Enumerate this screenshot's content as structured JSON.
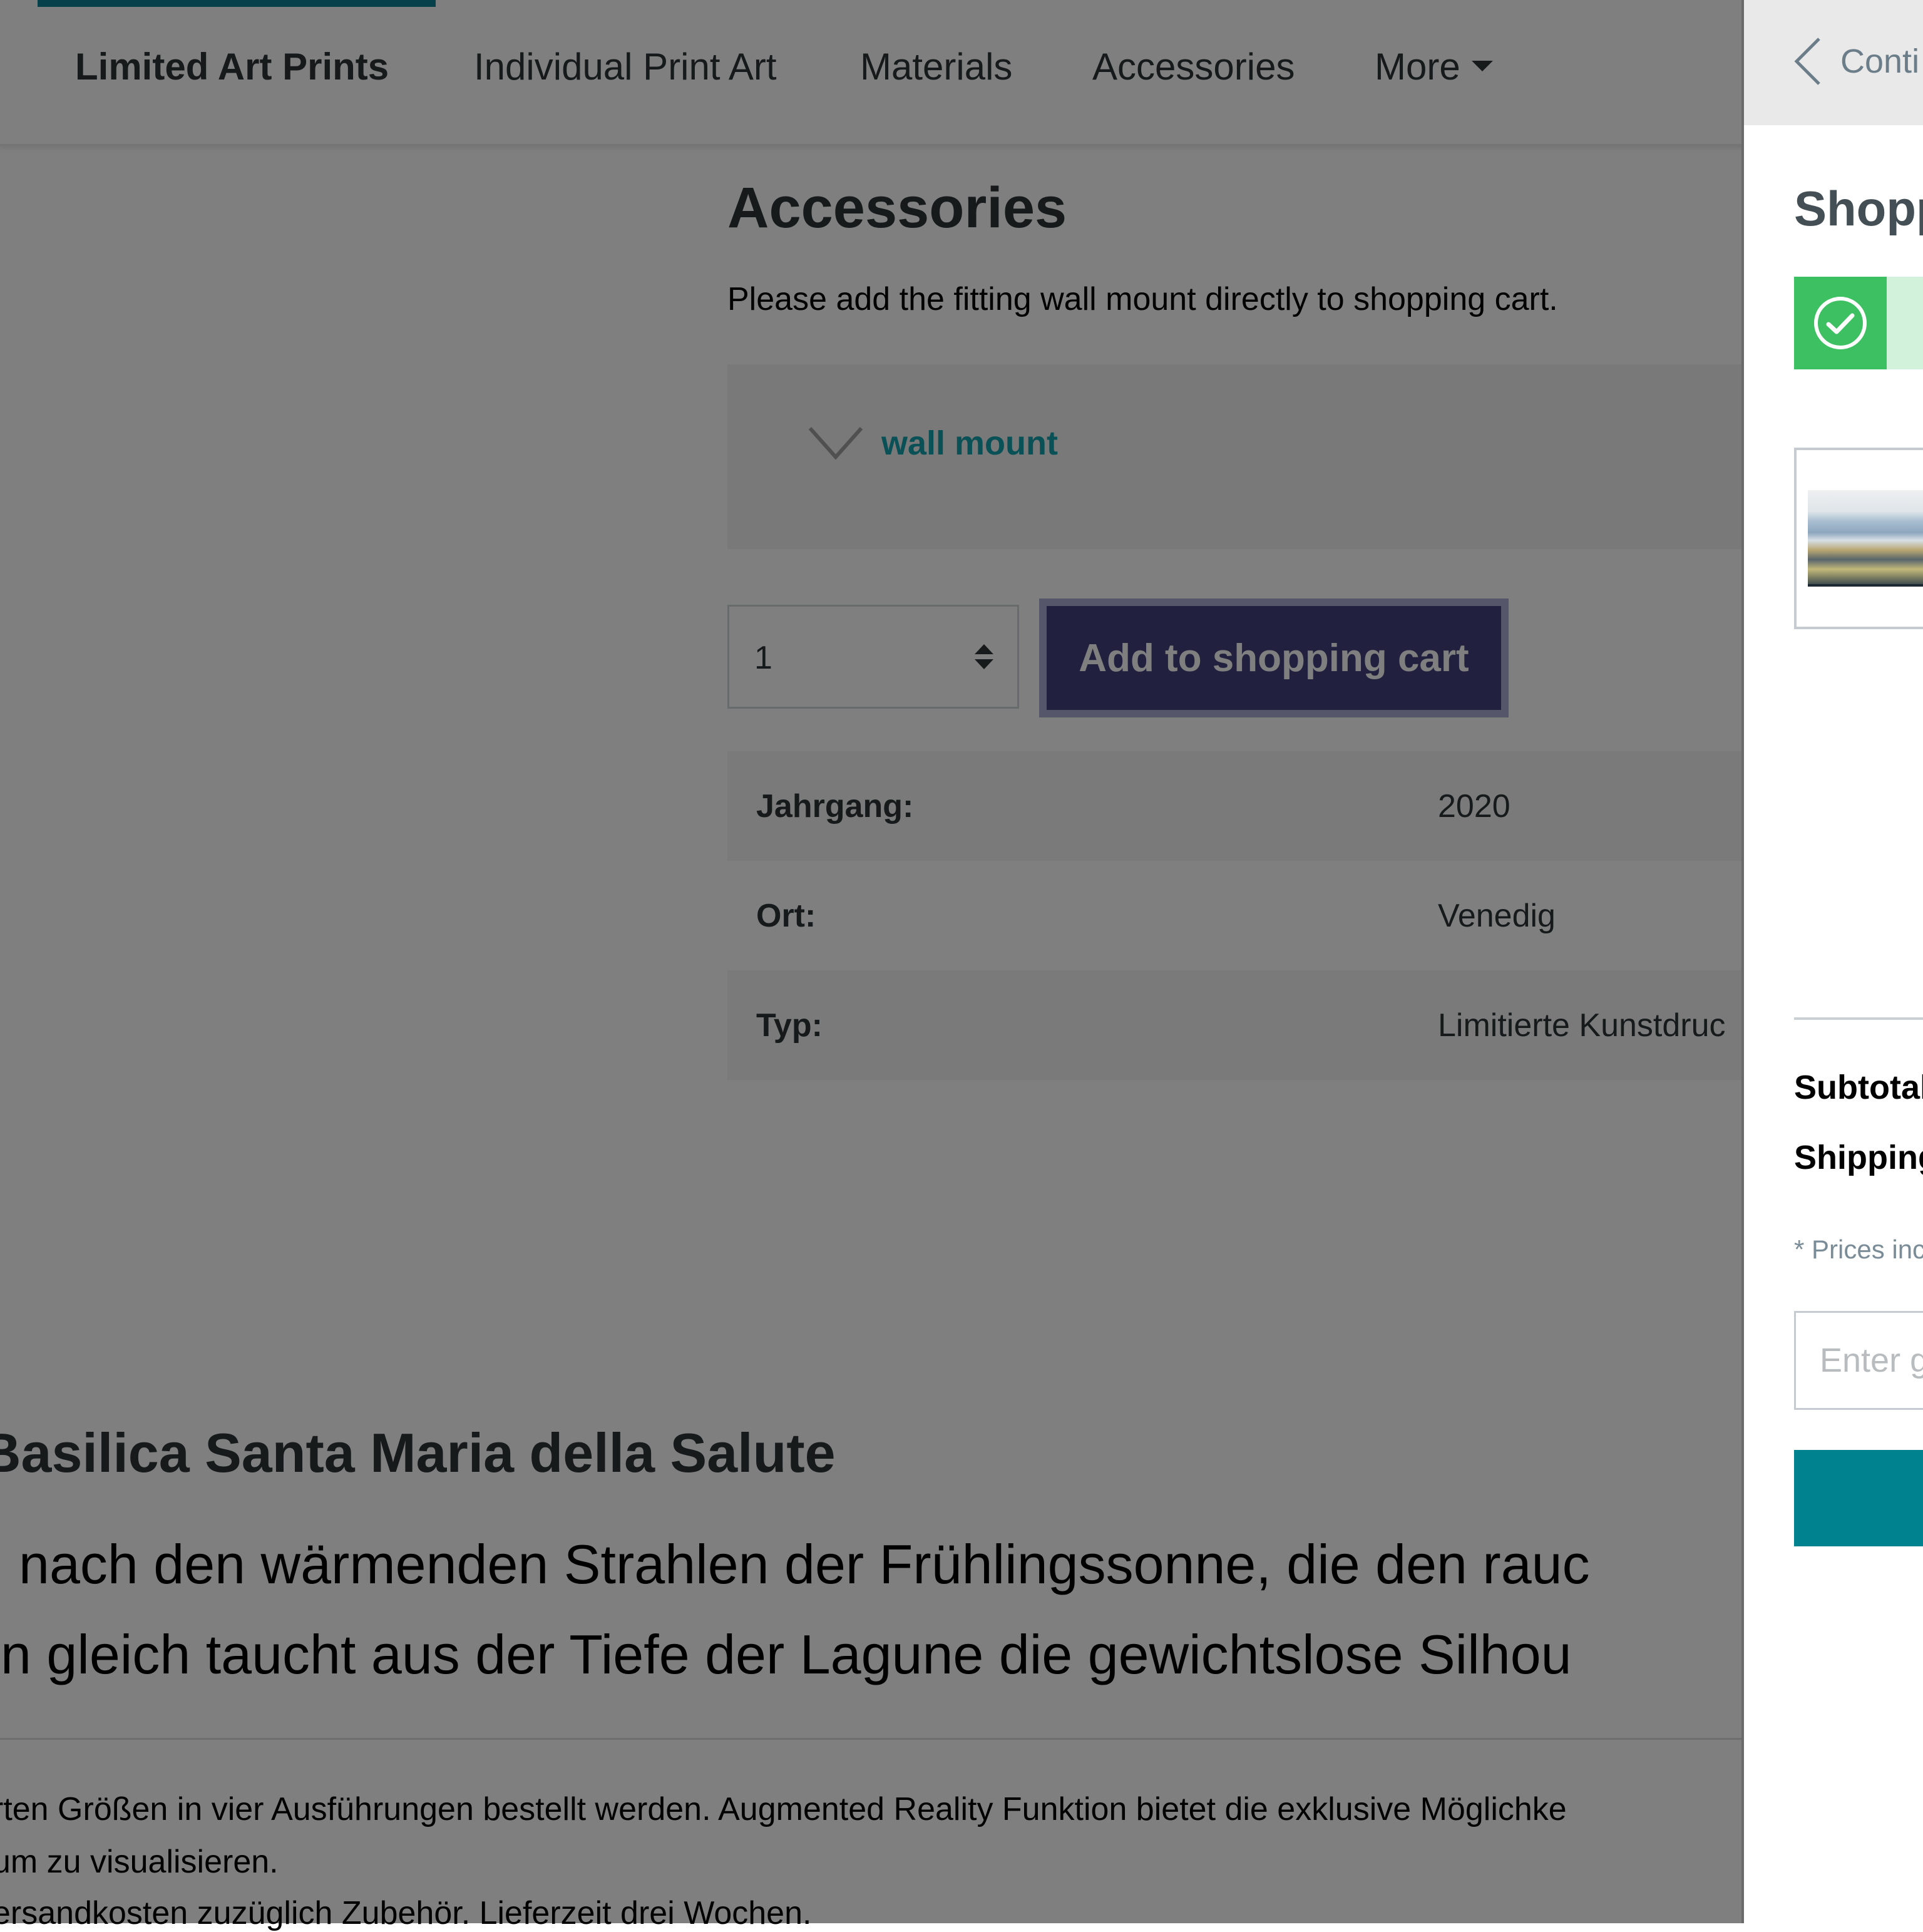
{
  "nav": {
    "items": [
      {
        "label": "Limited Art Prints",
        "active": true
      },
      {
        "label": "Individual Print Art",
        "active": false
      },
      {
        "label": "Materials",
        "active": false
      },
      {
        "label": "Accessories",
        "active": false
      },
      {
        "label": "More",
        "active": false
      }
    ],
    "more_icon": "caret-down-icon"
  },
  "accessories": {
    "title": "Accessories",
    "description": "Please add the fitting wall mount directly to shopping cart.",
    "wall_mount_label": "wall mount",
    "wall_mount_icon": "chevron-down-icon"
  },
  "buy": {
    "quantity": "1",
    "add_to_cart_label": "Add to shopping cart"
  },
  "properties": [
    {
      "label": "Jahrgang:",
      "value": "2020"
    },
    {
      "label": "Ort:",
      "value": "Venedig"
    },
    {
      "label": "Typ:",
      "value": "Limitierte Kunstdruc"
    }
  ],
  "artwork": {
    "title": "Basilica Santa Maria della Salute",
    "lede_lines": [
      "nach den wärmenden Strahlen der Frühlingssonne, die den  rauc",
      "on gleich taucht aus der Tiefe der Lagune die gewichtslose Silhou"
    ],
    "body_lines": [
      "rten Größen in vier Ausführungen bestellt werden. Augmented Reality Funktion bietet die exklusive Möglichke",
      "um zu visualisieren.",
      "ersandkosten zuzüglich Zubehör. Lieferzeit drei Wochen."
    ]
  },
  "cart": {
    "continue_label": "Conti",
    "continue_icon": "chevron-left-icon",
    "title": "Shopp",
    "success_icon": "check-circle-icon",
    "item_image": "venice-painting-thumbnail",
    "subtotal_label": "Subtotal",
    "shipping_label": "Shipping",
    "tax_note": "* Prices inc",
    "gift_placeholder": "Enter g",
    "checkout_label": ""
  },
  "colors": {
    "accent_teal": "#00838f",
    "button_navy": "#42407c",
    "success_green": "#3cc062",
    "success_bg": "#d3f2dc"
  }
}
